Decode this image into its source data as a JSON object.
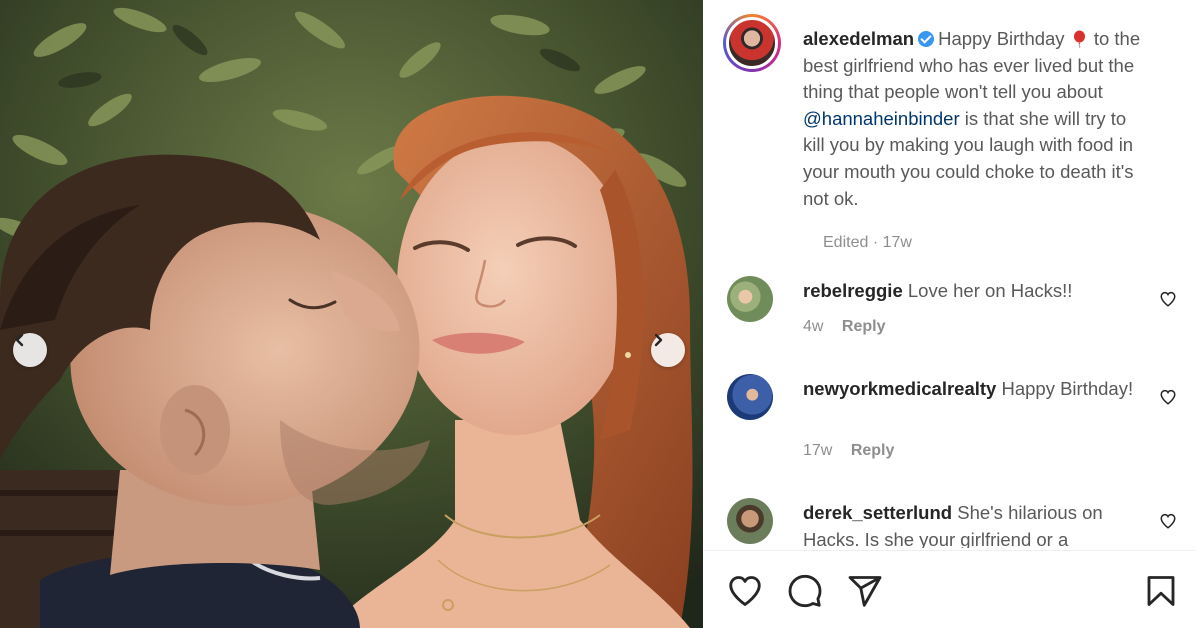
{
  "post": {
    "author": "alexedelman",
    "caption_before": "Happy Birthday ",
    "caption_mid": " to the best girlfriend who has ever lived but the thing that people won't tell you about ",
    "mention": "@hannaheinbinder",
    "caption_after": " is that she will try to kill you by making you laugh with food in your mouth you could choke to death it's not ok.",
    "meta": "Edited · 17w"
  },
  "comments": [
    {
      "username": "rebelreggie",
      "text": "Love her on Hacks!!",
      "time": "4w",
      "reply": "Reply"
    },
    {
      "username": "newyorkmedicalrealty",
      "text": "Happy Birthday!",
      "time": "17w",
      "reply": "Reply"
    },
    {
      "username": "derek_setterlund",
      "text": "She's hilarious on Hacks. Is she your girlfriend or a",
      "time": "",
      "reply": ""
    }
  ],
  "icons": {
    "prev": "chevron-left-icon",
    "next": "chevron-right-icon",
    "like": "heart-icon",
    "comment": "comment-icon",
    "share": "paper-plane-icon",
    "save": "bookmark-icon"
  },
  "colors": {
    "mention": "#00376b",
    "verified": "#3897f0",
    "muted": "#8e8e8e"
  }
}
